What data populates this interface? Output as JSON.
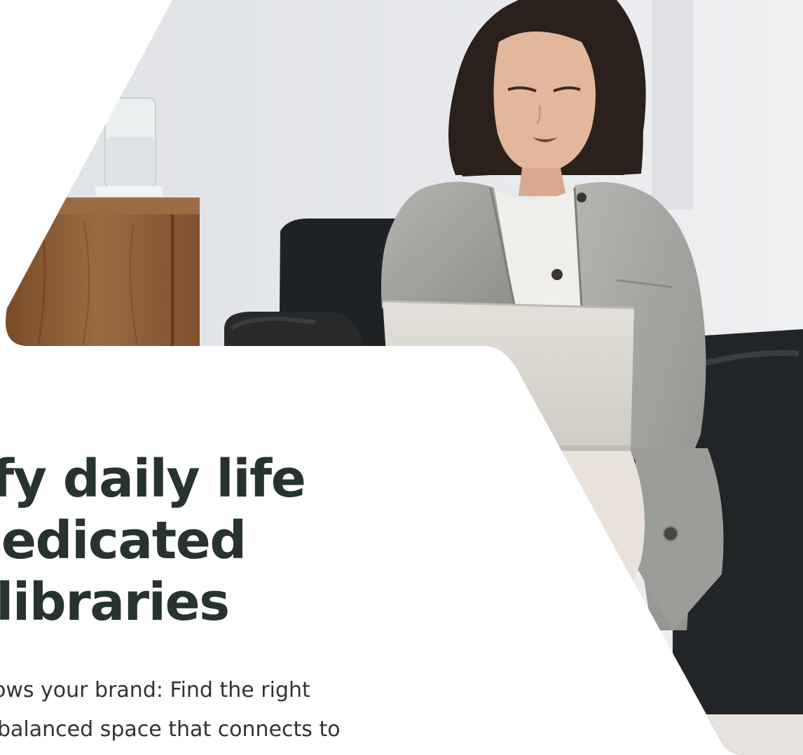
{
  "hero": {
    "headline_lines": [
      "fy daily life",
      "ledicated",
      " libraries"
    ],
    "body_lines": [
      "ows your brand: Find the right",
      "balanced space that connects to"
    ],
    "photo": {
      "subject": "photo",
      "colors": {
        "wall": "#e4e6ea",
        "wood": "#8a5a34",
        "sofa": "#232628",
        "jacket": "#a9a9a6",
        "hair": "#2b211c",
        "skin": "#e0b49a",
        "laptop": "#d9d6d0",
        "shirt": "#f1efec"
      }
    },
    "colors": {
      "headline": "#263330",
      "body": "#2f3533",
      "background": "#ffffff"
    }
  }
}
